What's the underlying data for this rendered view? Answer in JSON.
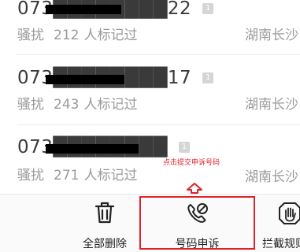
{
  "records": [
    {
      "number": "073████████22",
      "tag": "1",
      "category": "骚扰",
      "count": "212",
      "count_suffix": "人标记过",
      "location": "湖南长沙"
    },
    {
      "number": "073████████17",
      "tag": "1",
      "category": "骚扰",
      "count": "243",
      "count_suffix": "人标记过",
      "location": "湖南长沙"
    },
    {
      "number": "073████████",
      "tag": "1",
      "category": "骚扰",
      "count": "271",
      "count_suffix": "人标记过",
      "location": "湖南长沙"
    }
  ],
  "annotation": {
    "hint": "点击提交申诉号码",
    "color": "#e0202a"
  },
  "toolbar": {
    "delete_all": "全部删除",
    "appeal": "号码申诉",
    "block_rules": "拦截规则"
  },
  "icons": {
    "delete_all": "trash-icon",
    "appeal": "phone-slash-icon",
    "block_rules": "hand-stop-icon"
  }
}
